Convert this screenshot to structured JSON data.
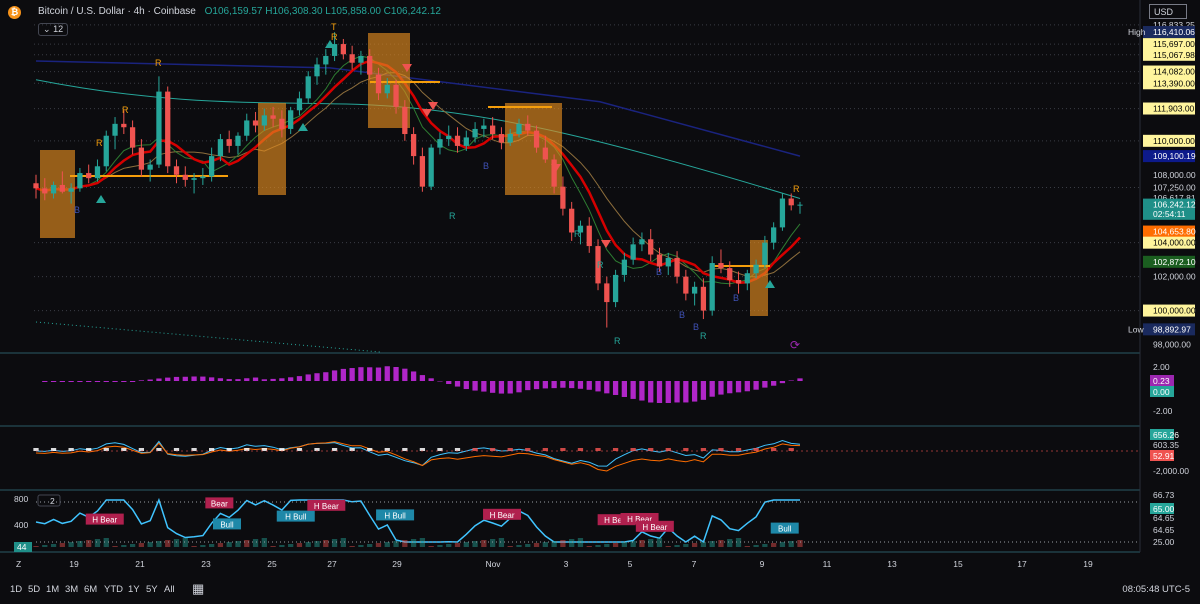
{
  "header": {
    "title": "Bitcoin / U.S. Dollar · 4h · Coinbase",
    "ohlc": "O106,159.57 H106,308.30 L105,858.00 C106,242.12",
    "currency": "USD",
    "collapse_count": "12"
  },
  "colors": {
    "up": "#26a69a",
    "down": "#ef5350",
    "background": "#0c0c0f",
    "macd_hist": "#9c27b0",
    "rsi_line": "#40c4ff",
    "orange": "#f59e0b",
    "red_line": "#d50000"
  },
  "chart_data": [
    {
      "type": "candlestick",
      "title": "Bitcoin / U.S. Dollar · 4h · Coinbase",
      "ylim": [
        97500,
        117000
      ],
      "x_ticks": [
        "19",
        "21",
        "23",
        "25",
        "27",
        "29",
        "Nov",
        "3",
        "5",
        "7",
        "9",
        "11",
        "13",
        "15",
        "17",
        "19"
      ],
      "y_ticks": [
        "116,833.25",
        "115,697.00",
        "115,067.98",
        "114,082.00",
        "113,390.00",
        "111,903.00",
        "110,000.00",
        "108,000.00",
        "107,250.00",
        "106,617.81",
        "104,653.80",
        "104,000.00",
        "102,000.00",
        "100,000.00",
        "98,000.00"
      ],
      "price_labels": [
        {
          "label": "High",
          "value": "116,410.06",
          "color": "#1e3a8a"
        },
        {
          "label": "",
          "value": "109,100.19",
          "color": "#0d47a1"
        },
        {
          "label": "",
          "value": "106,242.12",
          "color": "#26a69a"
        },
        {
          "label": "",
          "value": "02:54:11",
          "color": "#26a69a"
        },
        {
          "label": "",
          "value": "104,653.80",
          "color": "#ff6d00"
        },
        {
          "label": "",
          "value": "102,872.10",
          "color": "#1b5e20"
        },
        {
          "label": "Low",
          "value": "98,892.97",
          "color": "#1e3a8a"
        }
      ],
      "candles": [
        [
          107.5,
          108.0,
          106.6,
          107.2
        ],
        [
          107.2,
          107.8,
          106.5,
          106.9
        ],
        [
          106.9,
          107.6,
          106.6,
          107.4
        ],
        [
          107.4,
          108.2,
          106.9,
          107.0
        ],
        [
          107.0,
          107.5,
          106.3,
          107.2
        ],
        [
          107.2,
          108.4,
          107.0,
          108.1
        ],
        [
          108.1,
          108.6,
          107.5,
          107.8
        ],
        [
          107.8,
          108.9,
          107.6,
          108.5
        ],
        [
          108.5,
          110.6,
          108.2,
          110.3
        ],
        [
          110.3,
          111.4,
          109.5,
          111.0
        ],
        [
          111.0,
          111.8,
          110.4,
          110.8
        ],
        [
          110.8,
          111.2,
          109.2,
          109.6
        ],
        [
          109.6,
          110.1,
          107.9,
          108.3
        ],
        [
          108.3,
          108.9,
          107.6,
          108.6
        ],
        [
          108.6,
          113.8,
          108.4,
          112.9
        ],
        [
          112.9,
          113.2,
          108.1,
          108.5
        ],
        [
          108.5,
          108.9,
          107.5,
          108.0
        ],
        [
          108.0,
          108.5,
          107.3,
          107.7
        ],
        [
          107.7,
          108.1,
          106.9,
          107.8
        ],
        [
          107.8,
          108.4,
          107.4,
          107.9
        ],
        [
          107.9,
          109.6,
          107.6,
          109.1
        ],
        [
          109.1,
          110.4,
          108.8,
          110.1
        ],
        [
          110.1,
          110.6,
          109.3,
          109.7
        ],
        [
          109.7,
          110.5,
          109.2,
          110.3
        ],
        [
          110.3,
          111.6,
          110.0,
          111.2
        ],
        [
          111.2,
          111.7,
          110.5,
          110.9
        ],
        [
          110.9,
          111.9,
          110.6,
          111.5
        ],
        [
          111.5,
          112.0,
          110.8,
          111.3
        ],
        [
          111.3,
          111.8,
          110.2,
          110.7
        ],
        [
          110.7,
          112.0,
          110.4,
          111.8
        ],
        [
          111.8,
          112.9,
          111.5,
          112.5
        ],
        [
          112.5,
          114.1,
          112.2,
          113.8
        ],
        [
          113.8,
          114.9,
          113.3,
          114.5
        ],
        [
          114.5,
          115.4,
          113.9,
          115.0
        ],
        [
          115.0,
          116.4,
          114.7,
          115.7
        ],
        [
          115.7,
          116.0,
          114.8,
          115.1
        ],
        [
          115.1,
          115.6,
          114.2,
          114.6
        ],
        [
          114.6,
          115.3,
          113.9,
          115.0
        ],
        [
          115.0,
          115.4,
          113.6,
          113.9
        ],
        [
          113.9,
          114.3,
          112.4,
          112.8
        ],
        [
          112.8,
          113.7,
          112.5,
          113.3
        ],
        [
          113.3,
          113.6,
          111.6,
          112.0
        ],
        [
          112.0,
          112.4,
          110.0,
          110.4
        ],
        [
          110.4,
          110.8,
          108.6,
          109.1
        ],
        [
          109.1,
          109.6,
          107.0,
          107.3
        ],
        [
          107.3,
          109.8,
          107.1,
          109.6
        ],
        [
          109.6,
          110.5,
          109.2,
          110.1
        ],
        [
          110.1,
          110.9,
          109.7,
          110.3
        ],
        [
          110.3,
          110.8,
          109.3,
          109.7
        ],
        [
          109.7,
          110.6,
          109.4,
          110.2
        ],
        [
          110.2,
          111.1,
          109.9,
          110.7
        ],
        [
          110.7,
          111.3,
          110.2,
          110.9
        ],
        [
          110.9,
          111.4,
          110.1,
          110.4
        ],
        [
          110.4,
          110.8,
          109.5,
          109.9
        ],
        [
          109.9,
          110.7,
          109.7,
          110.4
        ],
        [
          110.4,
          111.3,
          110.2,
          111.0
        ],
        [
          111.0,
          111.5,
          110.3,
          110.6
        ],
        [
          110.6,
          110.9,
          109.3,
          109.6
        ],
        [
          109.6,
          110.3,
          108.7,
          108.9
        ],
        [
          108.9,
          109.2,
          106.9,
          107.3
        ],
        [
          107.3,
          107.9,
          105.6,
          106.0
        ],
        [
          106.0,
          106.4,
          104.1,
          104.6
        ],
        [
          104.6,
          105.3,
          103.9,
          105.0
        ],
        [
          105.0,
          105.5,
          103.4,
          103.8
        ],
        [
          103.8,
          104.2,
          101.2,
          101.6
        ],
        [
          101.6,
          102.0,
          99.0,
          100.5
        ],
        [
          100.5,
          102.4,
          100.2,
          102.1
        ],
        [
          102.1,
          103.4,
          101.7,
          103.0
        ],
        [
          103.0,
          104.3,
          102.7,
          103.9
        ],
        [
          103.9,
          104.6,
          103.5,
          104.2
        ],
        [
          104.2,
          104.8,
          102.9,
          103.3
        ],
        [
          103.3,
          103.7,
          102.3,
          102.6
        ],
        [
          102.6,
          103.4,
          102.1,
          103.1
        ],
        [
          103.1,
          103.5,
          101.6,
          102.0
        ],
        [
          102.0,
          102.4,
          100.6,
          101.0
        ],
        [
          101.0,
          101.7,
          100.3,
          101.4
        ],
        [
          101.4,
          101.9,
          99.5,
          100.0
        ],
        [
          100.0,
          103.2,
          99.7,
          102.8
        ],
        [
          102.8,
          103.6,
          102.2,
          102.5
        ],
        [
          102.5,
          102.9,
          101.4,
          101.8
        ],
        [
          101.8,
          102.3,
          101.0,
          101.6
        ],
        [
          101.6,
          102.4,
          101.2,
          102.2
        ],
        [
          102.2,
          103.0,
          101.9,
          102.7
        ],
        [
          102.7,
          104.4,
          102.5,
          104.0
        ],
        [
          104.0,
          105.2,
          103.6,
          104.9
        ],
        [
          104.9,
          106.9,
          104.7,
          106.6
        ],
        [
          106.6,
          106.9,
          105.9,
          106.2
        ],
        [
          106.2,
          106.4,
          105.7,
          106.24
        ]
      ]
    },
    {
      "type": "bar",
      "title": "",
      "y_ticks": [
        "2.00",
        "-2.00"
      ],
      "price_labels": [
        {
          "label": "",
          "value": "0.23",
          "color": "#9c27b0"
        },
        {
          "label": "",
          "value": "0.00",
          "color": "#26a69a"
        }
      ]
    },
    {
      "type": "line",
      "title": "",
      "y_ticks": [
        "-2,000.00"
      ],
      "price_labels": [
        {
          "label": "",
          "value": "656.26",
          "color": "#26a69a"
        },
        {
          "label": "",
          "value": "603.35",
          "color": "#2a2e39"
        },
        {
          "label": "",
          "value": "52.91",
          "color": "#ef5350"
        }
      ]
    },
    {
      "type": "line",
      "title": "",
      "y_ticks": [
        "66.73",
        "65.00",
        "64.65",
        "64.65",
        "25.00"
      ],
      "left_ticks": [
        "800",
        "400"
      ],
      "left_badge": "44",
      "collapse_count": "2",
      "price_labels": [
        {
          "label": "",
          "value": "65.00",
          "color": "#26a69a"
        }
      ],
      "annotations": [
        {
          "text": "H Bear",
          "kind": "bear",
          "x": 0.09,
          "y": 0.46
        },
        {
          "text": "Bear",
          "kind": "bear",
          "x": 0.24,
          "y": 0.19
        },
        {
          "text": "Bull",
          "kind": "bull",
          "x": 0.25,
          "y": 0.54
        },
        {
          "text": "H Bull",
          "kind": "bull",
          "x": 0.34,
          "y": 0.41
        },
        {
          "text": "H Bear",
          "kind": "bear",
          "x": 0.38,
          "y": 0.23
        },
        {
          "text": "H Bull",
          "kind": "bull",
          "x": 0.47,
          "y": 0.39
        },
        {
          "text": "H Bear",
          "kind": "bear",
          "x": 0.61,
          "y": 0.38
        },
        {
          "text": "H Bear",
          "kind": "bear",
          "x": 0.76,
          "y": 0.47
        },
        {
          "text": "H Bear",
          "kind": "bear",
          "x": 0.79,
          "y": 0.45
        },
        {
          "text": "H Bear",
          "kind": "bear",
          "x": 0.81,
          "y": 0.58
        },
        {
          "text": "Bull",
          "kind": "bull",
          "x": 0.98,
          "y": 0.61
        }
      ]
    }
  ],
  "toolbar": {
    "ranges": [
      "1D",
      "5D",
      "1M",
      "3M",
      "6M",
      "YTD",
      "1Y",
      "5Y",
      "All"
    ],
    "clock": "08:05:48 UTC-5"
  }
}
